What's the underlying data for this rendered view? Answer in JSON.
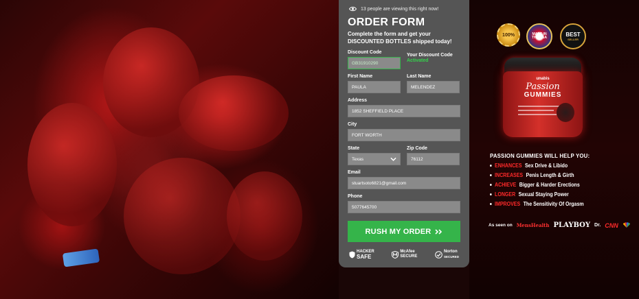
{
  "form": {
    "viewing_text": "13 people are viewing this right now!",
    "title": "ORDER FORM",
    "subtitle_line1": "Complete the form and get your",
    "subtitle_line2": "DISCOUNTED BOTTLES shipped today!",
    "discount_label": "Discount Code",
    "discount_value": "GB31910290",
    "discount_status_label": "Your Discount Code",
    "discount_status_value": "Activated",
    "first_name_label": "First Name",
    "first_name_value": "PAULA",
    "last_name_label": "Last Name",
    "last_name_value": "MELENDEZ",
    "address_label": "Address",
    "address_value": "1852 SHEFFIELD PLACE",
    "city_label": "City",
    "city_value": "FORT WORTH",
    "state_label": "State",
    "state_value": "Texas",
    "zip_label": "Zip Code",
    "zip_value": "76112",
    "email_label": "Email",
    "email_value": "stuartsoto6821@gmail.com",
    "phone_label": "Phone",
    "phone_value": "5077645700",
    "submit_label": "RUSH MY ORDER",
    "submit_color": "#35b44a"
  },
  "security_badges": {
    "hacker_safe_top": "HACKER",
    "hacker_safe_bottom": "SAFE",
    "mcafee_top": "McAfee",
    "mcafee_bottom": "SECURE",
    "norton_top": "Norton",
    "norton_bottom": "SECURED"
  },
  "seals": {
    "satisfaction": "100%",
    "usa": "MADE IN THE USA",
    "best": "BEST",
    "best_sub": "SELLER"
  },
  "product": {
    "brand": "unabis",
    "name": "Passion",
    "type": "GUMMIES"
  },
  "benefits": {
    "title": "PASSION GUMMIES WILL HELP YOU:",
    "items": [
      {
        "highlight": "ENHANCES",
        "text": "Sex Drive & Libido"
      },
      {
        "highlight": "INCREASES",
        "text": "Penis Length & Girth"
      },
      {
        "highlight": "ACHIEVE",
        "text": "Bigger & Harder Erections"
      },
      {
        "highlight": "LONGER",
        "text": "Sexual Staying Power"
      },
      {
        "highlight": "IMPROVES",
        "text": "The Sensitivity Of Orgasm"
      }
    ]
  },
  "as_seen_on": {
    "label": "As seen on",
    "outlets": [
      "MensHealth",
      "PLAYBOY",
      "Dr.",
      "CNN"
    ]
  },
  "colors": {
    "accent_green": "#35b44a",
    "highlight_red": "#ff2a2a",
    "panel_gray": "#555555"
  }
}
